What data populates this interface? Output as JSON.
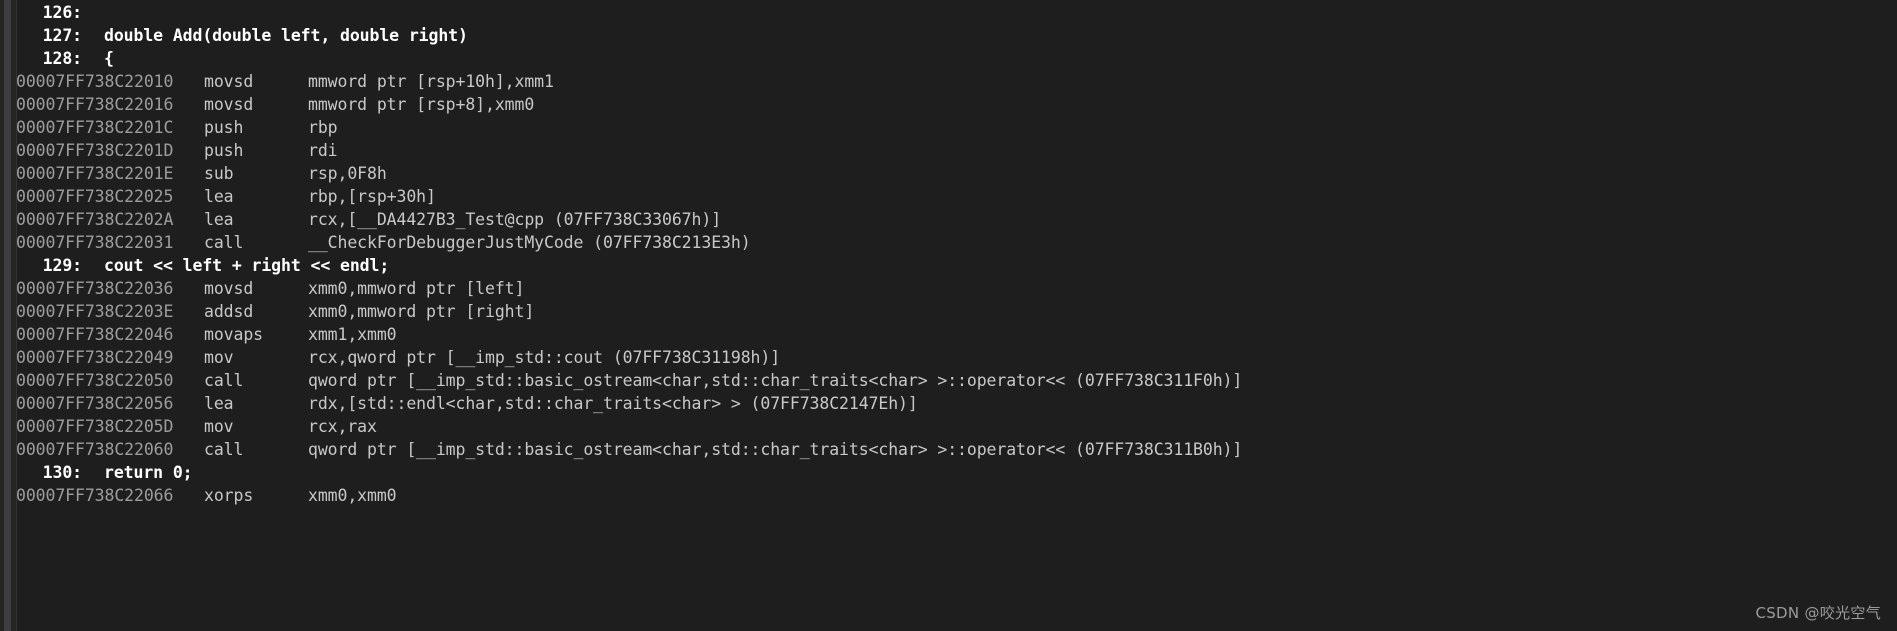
{
  "view": {
    "name": "disassembly-view",
    "theme": "dark",
    "background_color": "#1e1e1e",
    "address_color": "#9d9d9d",
    "code_color": "#c8c8c8",
    "source_color": "#ffffff"
  },
  "lines": [
    {
      "type": "source",
      "number": "126:",
      "text": ""
    },
    {
      "type": "source",
      "number": "127:",
      "text": "double Add(double left, double right)"
    },
    {
      "type": "source",
      "number": "128:",
      "text": "{"
    },
    {
      "type": "asm",
      "address": "00007FF738C22010",
      "mnemonic": "movsd",
      "operands": "mmword ptr [rsp+10h],xmm1"
    },
    {
      "type": "asm",
      "address": "00007FF738C22016",
      "mnemonic": "movsd",
      "operands": "mmword ptr [rsp+8],xmm0"
    },
    {
      "type": "asm",
      "address": "00007FF738C2201C",
      "mnemonic": "push",
      "operands": "rbp"
    },
    {
      "type": "asm",
      "address": "00007FF738C2201D",
      "mnemonic": "push",
      "operands": "rdi"
    },
    {
      "type": "asm",
      "address": "00007FF738C2201E",
      "mnemonic": "sub",
      "operands": "rsp,0F8h"
    },
    {
      "type": "asm",
      "address": "00007FF738C22025",
      "mnemonic": "lea",
      "operands": "rbp,[rsp+30h]"
    },
    {
      "type": "asm",
      "address": "00007FF738C2202A",
      "mnemonic": "lea",
      "operands": "rcx,[__DA4427B3_Test@cpp (07FF738C33067h)]"
    },
    {
      "type": "asm",
      "address": "00007FF738C22031",
      "mnemonic": "call",
      "operands": "__CheckForDebuggerJustMyCode (07FF738C213E3h)"
    },
    {
      "type": "source",
      "number": "129:",
      "text": "cout << left + right << endl;"
    },
    {
      "type": "asm",
      "address": "00007FF738C22036",
      "mnemonic": "movsd",
      "operands": "xmm0,mmword ptr [left]"
    },
    {
      "type": "asm",
      "address": "00007FF738C2203E",
      "mnemonic": "addsd",
      "operands": "xmm0,mmword ptr [right]"
    },
    {
      "type": "asm",
      "address": "00007FF738C22046",
      "mnemonic": "movaps",
      "operands": "xmm1,xmm0"
    },
    {
      "type": "asm",
      "address": "00007FF738C22049",
      "mnemonic": "mov",
      "operands": "rcx,qword ptr [__imp_std::cout (07FF738C31198h)]"
    },
    {
      "type": "asm",
      "address": "00007FF738C22050",
      "mnemonic": "call",
      "operands": "qword ptr [__imp_std::basic_ostream<char,std::char_traits<char> >::operator<< (07FF738C311F0h)]"
    },
    {
      "type": "asm",
      "address": "00007FF738C22056",
      "mnemonic": "lea",
      "operands": "rdx,[std::endl<char,std::char_traits<char> > (07FF738C2147Eh)]"
    },
    {
      "type": "asm",
      "address": "00007FF738C2205D",
      "mnemonic": "mov",
      "operands": "rcx,rax"
    },
    {
      "type": "asm",
      "address": "00007FF738C22060",
      "mnemonic": "call",
      "operands": "qword ptr [__imp_std::basic_ostream<char,std::char_traits<char> >::operator<< (07FF738C311B0h)]"
    },
    {
      "type": "source",
      "number": "130:",
      "text": "return 0;"
    },
    {
      "type": "asm",
      "address": "00007FF738C22066",
      "mnemonic": "xorps",
      "operands": "xmm0,xmm0"
    }
  ],
  "watermark": {
    "text": "CSDN @咬光空气"
  }
}
